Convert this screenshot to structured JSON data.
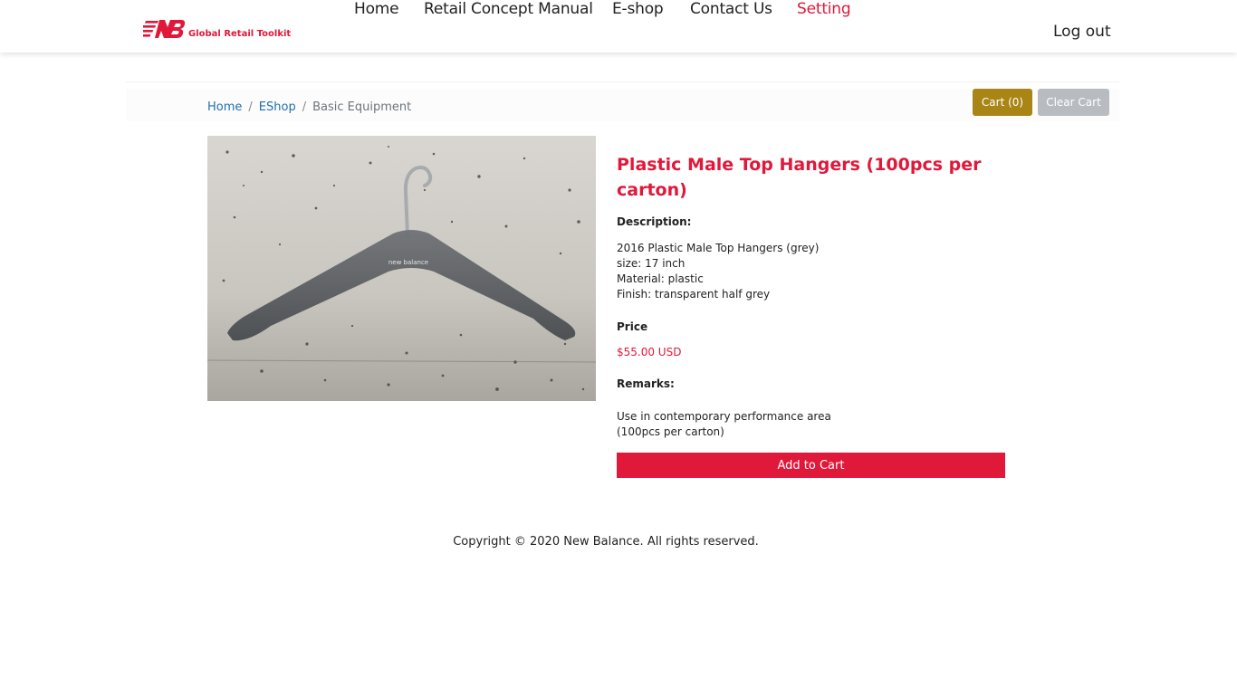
{
  "brand": {
    "logo_text": "Global Retail Toolkit",
    "logo_icon": "new-balance-nb-logo",
    "accent": "#e0183a"
  },
  "nav": {
    "items": [
      "Home",
      "Retail Concept Manual",
      "E-shop",
      "Contact Us",
      "Setting"
    ],
    "active": "Setting",
    "logout": "Log out"
  },
  "breadcrumb": {
    "home": "Home",
    "eshop": "EShop",
    "current": "Basic Equipment",
    "separator": "/"
  },
  "cart": {
    "cart_label": "Cart (0)",
    "clear_label": "Clear Cart"
  },
  "product": {
    "title": "Plastic Male Top Hangers (100pcs per carton)",
    "image_subject": "grey plastic hanger on concrete floor",
    "image_brand_text": "new balance",
    "description_label": "Description:",
    "description_lines": [
      "2016 Plastic Male Top Hangers (grey)",
      "size: 17 inch",
      "Material: plastic",
      "Finish: transparent half grey"
    ],
    "price_label": "Price",
    "price": "$55.00 USD",
    "remarks_label": "Remarks:",
    "remarks_lines": [
      "Use in contemporary performance area",
      "(100pcs per carton)"
    ],
    "add_to_cart": "Add to Cart"
  },
  "footer": {
    "copyright": "Copyright © 2020 New Balance. All rights reserved."
  }
}
